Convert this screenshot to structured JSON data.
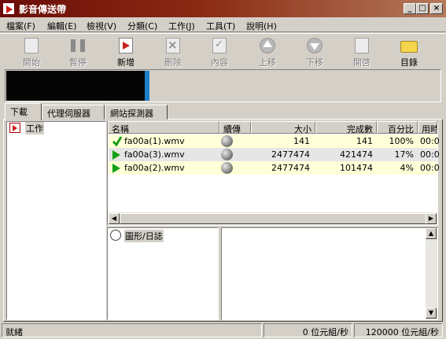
{
  "window": {
    "title": "影音傳送帶",
    "min_glyph": "_",
    "max_glyph": "□",
    "close_glyph": "×"
  },
  "menu": [
    "檔案(F)",
    "編輯(E)",
    "檢視(V)",
    "分類(C)",
    "工作(J)",
    "工具(T)",
    "說明(H)"
  ],
  "toolbar": [
    {
      "label": "開始",
      "enabled": false,
      "icon": "start-icon"
    },
    {
      "label": "暫停",
      "enabled": false,
      "icon": "pause-icon"
    },
    {
      "label": "新增",
      "enabled": true,
      "icon": "add-icon"
    },
    {
      "label": "刪除",
      "enabled": false,
      "icon": "delete-icon"
    },
    {
      "label": "內容",
      "enabled": false,
      "icon": "properties-icon"
    },
    {
      "label": "上移",
      "enabled": false,
      "icon": "move-up-icon"
    },
    {
      "label": "下移",
      "enabled": false,
      "icon": "move-down-icon"
    },
    {
      "label": "開啓",
      "enabled": false,
      "icon": "open-icon"
    },
    {
      "label": "目錄",
      "enabled": true,
      "icon": "folder-icon"
    }
  ],
  "tabs": [
    "下載",
    "代理伺服器",
    "網站探測器"
  ],
  "tree": {
    "root": "工作"
  },
  "list": {
    "columns": [
      "名稱",
      "續傳",
      "大小",
      "完成數",
      "百分比",
      "用時"
    ],
    "rows": [
      {
        "status": "completed",
        "name": "fa00a(1).wmv",
        "size": "141",
        "done": "141",
        "percent": "100%",
        "time": "00:0"
      },
      {
        "status": "downloading",
        "name": "fa00a(3).wmv",
        "size": "2477474",
        "done": "421474",
        "percent": "17%",
        "time": "00:0"
      },
      {
        "status": "downloading",
        "name": "fa00a(2).wmv",
        "size": "2477474",
        "done": "101474",
        "percent": "4%",
        "time": "00:0"
      }
    ]
  },
  "info_panel": {
    "label": "圖形/日誌"
  },
  "statusbar": {
    "text": "就緒",
    "speed1": "0 位元組/秒",
    "speed2": "120000 位元組/秒"
  },
  "colors": {
    "title_start": "#6b0d06",
    "graph_bg": "#050505",
    "graph_accent": "#1c7ec8",
    "row_highlight": "#ffffd8",
    "row_selected": "#e6e6e6",
    "play_green": "#16a016",
    "check_green": "#1a9a1a"
  }
}
